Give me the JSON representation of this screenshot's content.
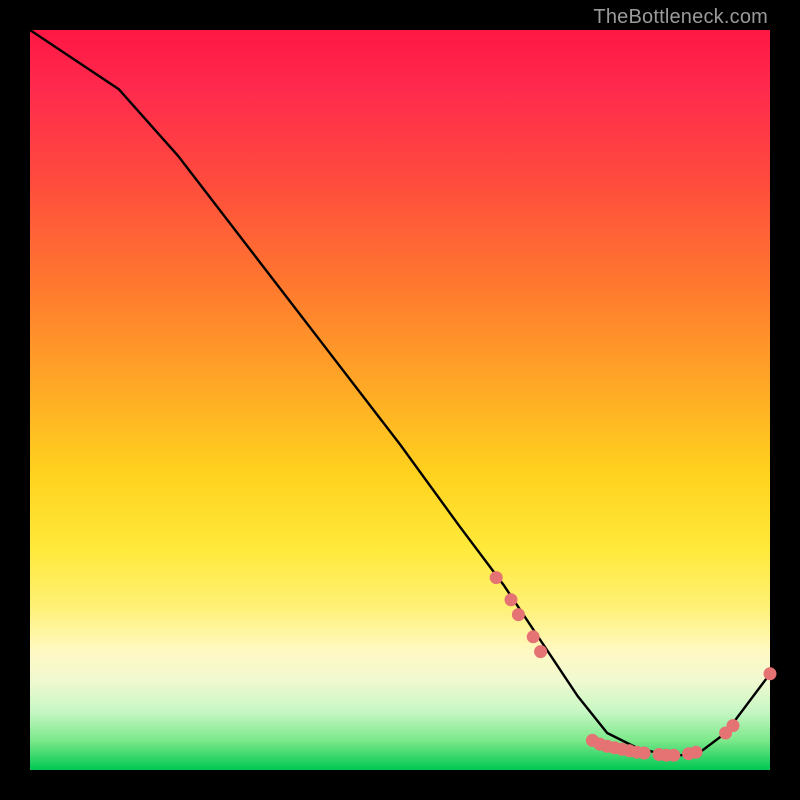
{
  "watermark": "TheBottleneck.com",
  "chart_data": {
    "type": "line",
    "title": "",
    "xlabel": "",
    "ylabel": "",
    "xlim": [
      0,
      100
    ],
    "ylim": [
      0,
      100
    ],
    "grid": false,
    "legend": false,
    "series": [
      {
        "name": "bottleneck-curve",
        "x": [
          0,
          6,
          12,
          20,
          30,
          40,
          50,
          58,
          64,
          70,
          74,
          78,
          82,
          86,
          90,
          94,
          100
        ],
        "y": [
          100,
          96,
          92,
          83,
          70,
          57,
          44,
          33,
          25,
          16,
          10,
          5,
          3,
          2,
          2,
          5,
          13
        ]
      }
    ],
    "markers": [
      {
        "x": 63,
        "y": 26
      },
      {
        "x": 65,
        "y": 23
      },
      {
        "x": 66,
        "y": 21
      },
      {
        "x": 68,
        "y": 18
      },
      {
        "x": 69,
        "y": 16
      },
      {
        "x": 76,
        "y": 4
      },
      {
        "x": 77,
        "y": 3.5
      },
      {
        "x": 78,
        "y": 3.2
      },
      {
        "x": 79,
        "y": 3
      },
      {
        "x": 80,
        "y": 2.8
      },
      {
        "x": 81,
        "y": 2.6
      },
      {
        "x": 82,
        "y": 2.4
      },
      {
        "x": 83,
        "y": 2.3
      },
      {
        "x": 85,
        "y": 2.1
      },
      {
        "x": 86,
        "y": 2.0
      },
      {
        "x": 87,
        "y": 2.0
      },
      {
        "x": 89,
        "y": 2.2
      },
      {
        "x": 90,
        "y": 2.4
      },
      {
        "x": 94,
        "y": 5
      },
      {
        "x": 95,
        "y": 6
      },
      {
        "x": 100,
        "y": 13
      }
    ],
    "marker_color": "#e57373",
    "line_color": "#000000"
  }
}
